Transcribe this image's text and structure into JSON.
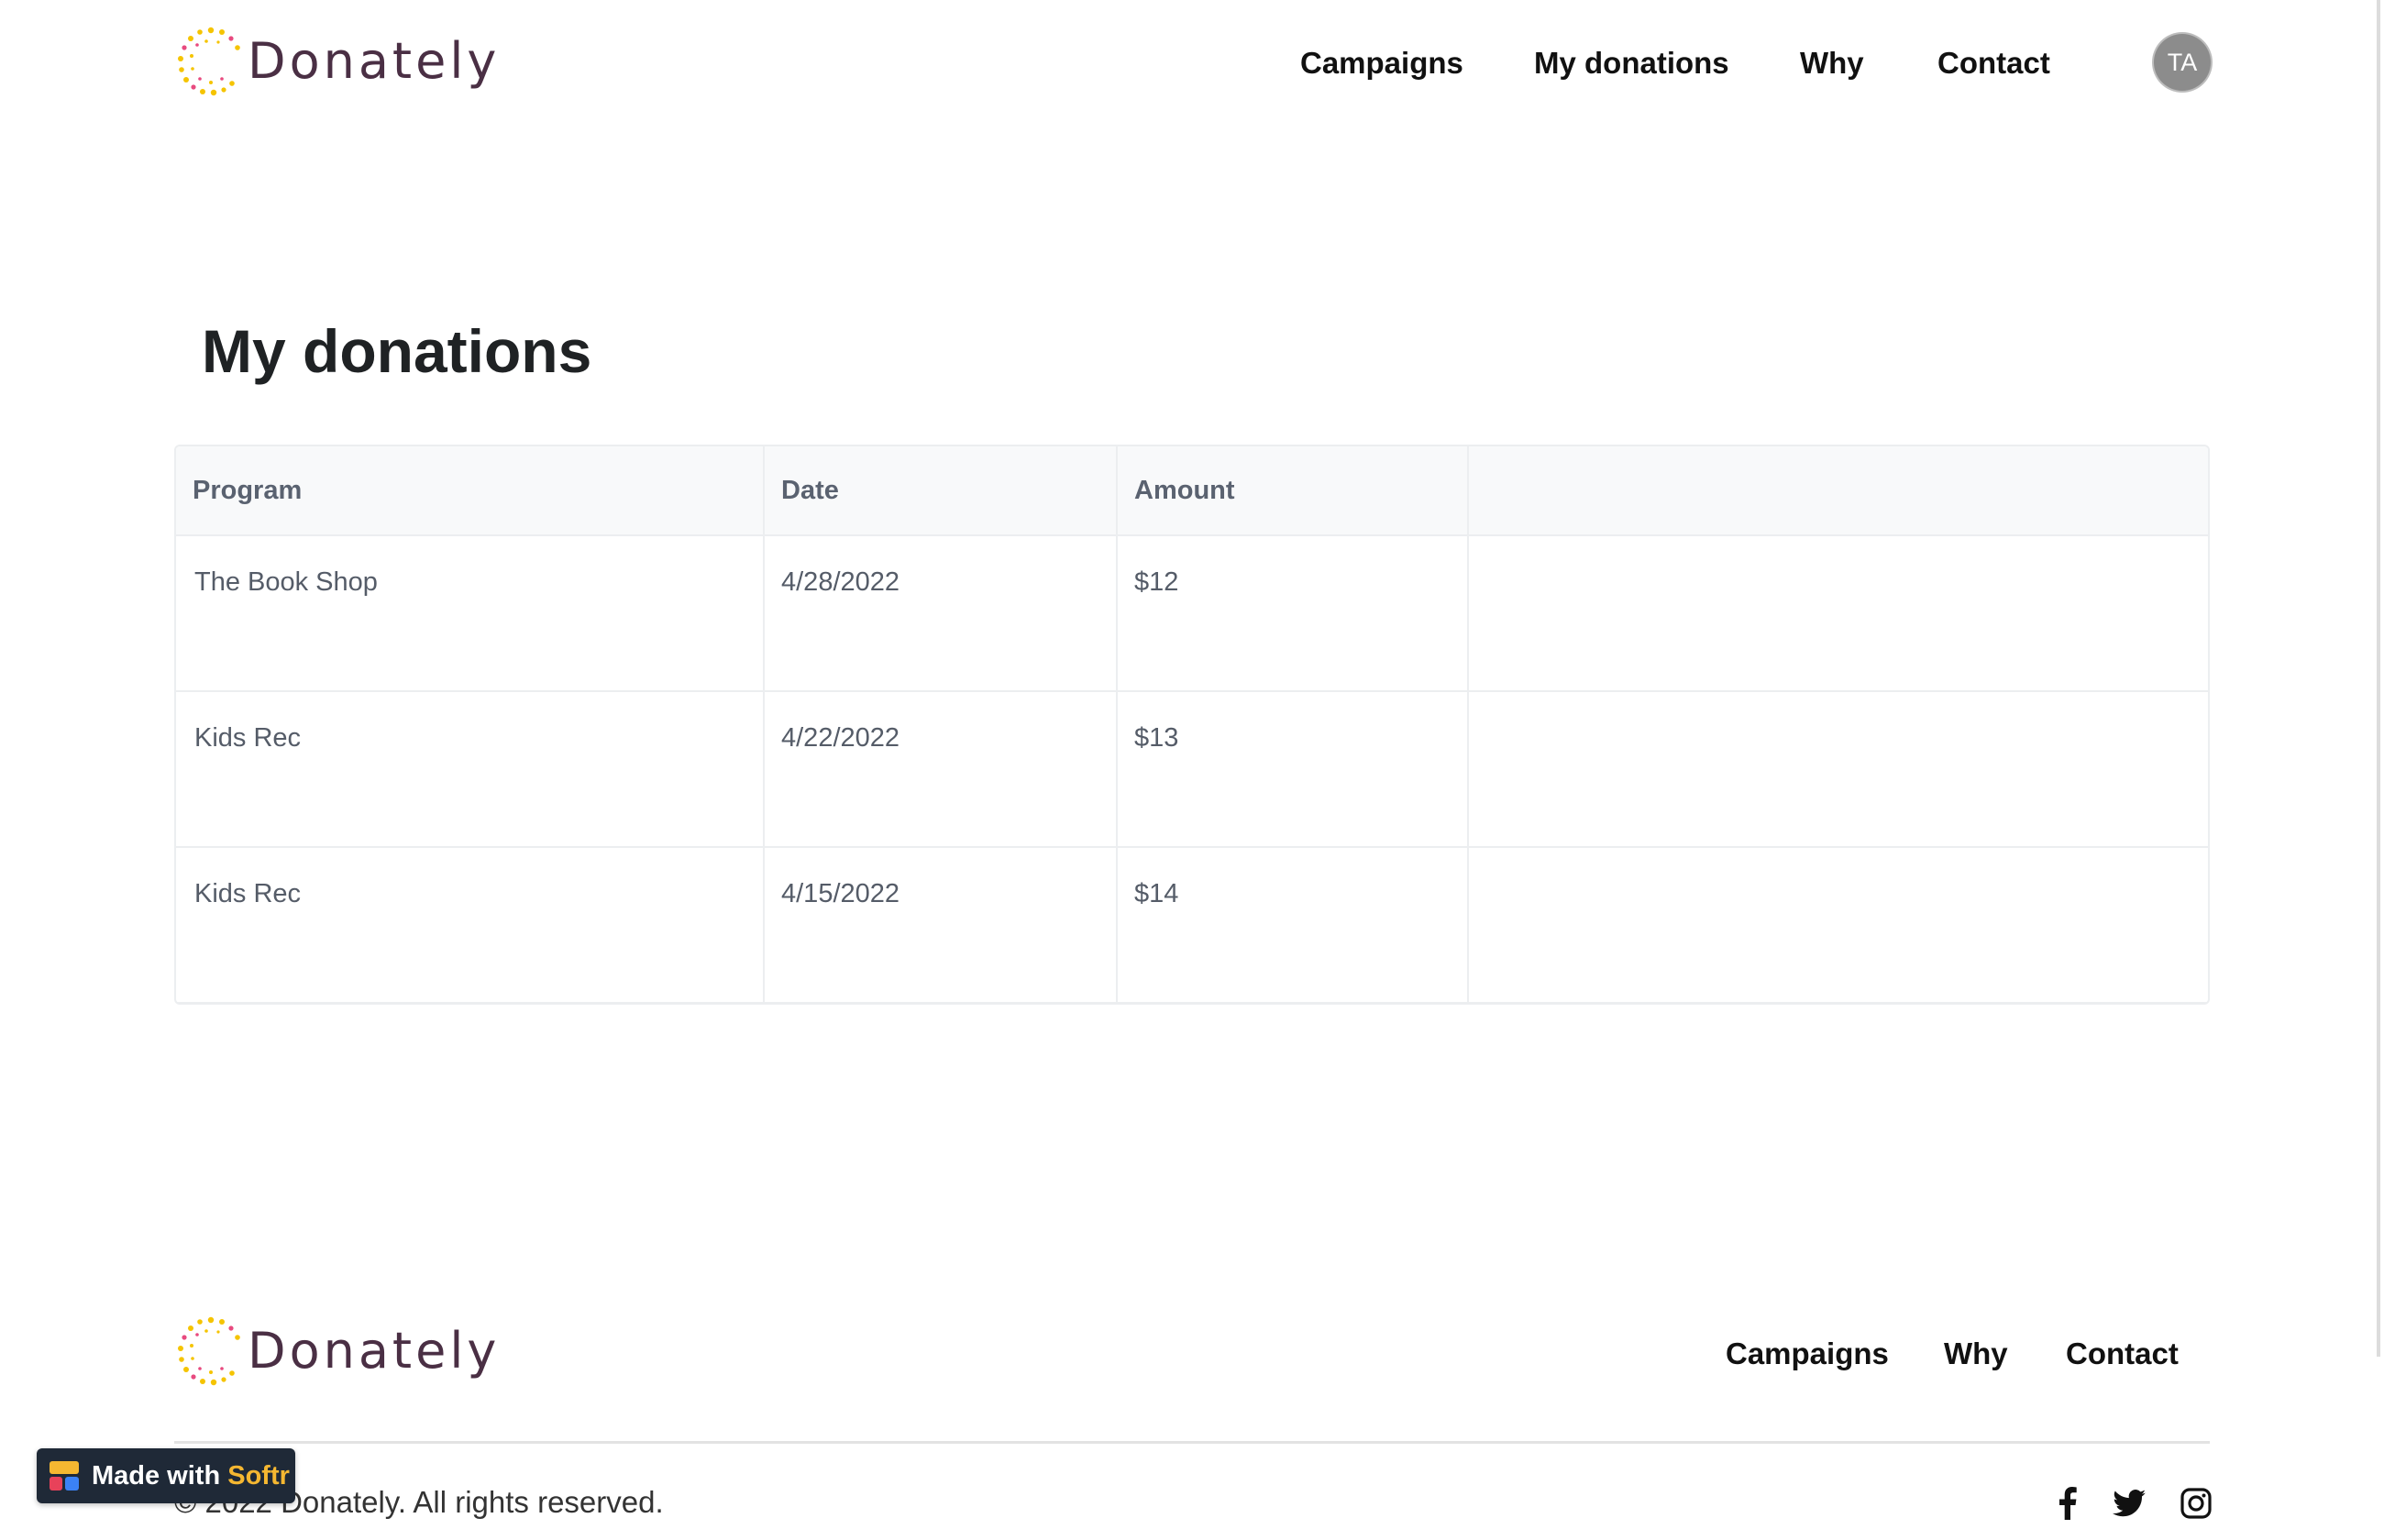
{
  "brand": {
    "name": "Donately",
    "text_color": "#4a2f44",
    "logo_dot_colors": [
      "#f5c400",
      "#e84a7f"
    ]
  },
  "header": {
    "nav": [
      {
        "label": "Campaigns"
      },
      {
        "label": "My donations"
      },
      {
        "label": "Why"
      },
      {
        "label": "Contact"
      }
    ],
    "avatar_initials": "TA"
  },
  "main": {
    "title": "My donations",
    "table": {
      "columns": [
        "Program",
        "Date",
        "Amount",
        ""
      ],
      "rows": [
        {
          "program": "The Book Shop",
          "date": "4/28/2022",
          "amount": "$12"
        },
        {
          "program": "Kids Rec",
          "date": "4/22/2022",
          "amount": "$13"
        },
        {
          "program": "Kids Rec",
          "date": "4/15/2022",
          "amount": "$14"
        }
      ]
    }
  },
  "footer": {
    "nav": [
      {
        "label": "Campaigns"
      },
      {
        "label": "Why"
      },
      {
        "label": "Contact"
      }
    ],
    "copyright": "© 2022 Donately. All rights reserved.",
    "social_icons": [
      "facebook-icon",
      "twitter-icon",
      "instagram-icon"
    ]
  },
  "badge": {
    "prefix": "Made with ",
    "brand": "Softr",
    "brand_color": "#f5b731"
  }
}
